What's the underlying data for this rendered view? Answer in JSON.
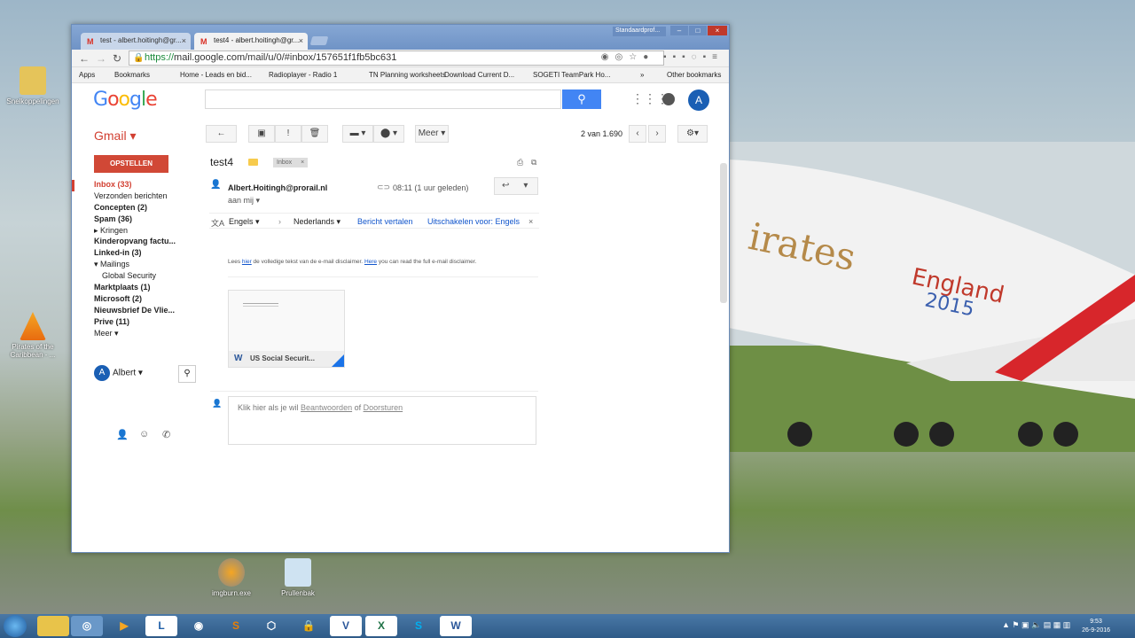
{
  "desktop": {
    "icons": [
      {
        "label": "Snelkoppelingen"
      },
      {
        "label": "Pirates of the Caribbean - ..."
      },
      {
        "label": "imgburn.exe"
      },
      {
        "label": "Prullenbak"
      }
    ]
  },
  "browser": {
    "tabs": [
      {
        "label": "test - albert.hoitingh@gr..."
      },
      {
        "label": "test4 - albert.hoitingh@gr..."
      }
    ],
    "profile": "Standaardprof...",
    "url_secure": "https://",
    "url_rest": "mail.google.com/mail/u/0/#inbox/157651f1fb5bc631",
    "bookmarks": [
      "Apps",
      "Bookmarks",
      "Home - Leads en bid...",
      "Radioplayer - Radio 1",
      "TN Planning worksheets",
      "Download Current D...",
      "SOGETI TeamPark Ho...",
      "»",
      "Other bookmarks"
    ]
  },
  "gmail": {
    "logo": "Google",
    "app_label": "Gmail ▾",
    "avatar_letter": "A",
    "toolbar": {
      "back": "←",
      "archive": "▣",
      "spam": "!",
      "delete": "🗑",
      "move": "▬ ▾",
      "labels": "⬤ ▾",
      "more": "Meer ▾"
    },
    "pager": "2 van 1.690",
    "compose": "OPSTELLEN",
    "labels": [
      {
        "text": "Inbox (33)",
        "style": "active"
      },
      {
        "text": "Verzonden berichten",
        "style": ""
      },
      {
        "text": "Concepten (2)",
        "style": "bold"
      },
      {
        "text": "Spam (36)",
        "style": "bold"
      },
      {
        "text": "▸ Kringen",
        "style": ""
      },
      {
        "text": "Kinderopvang factu...",
        "style": "bold"
      },
      {
        "text": "Linked-in (3)",
        "style": "bold"
      },
      {
        "text": "▾ Mailings",
        "style": ""
      },
      {
        "text": "Global Security",
        "style": "sub"
      },
      {
        "text": "Marktplaats (1)",
        "style": "bold"
      },
      {
        "text": "Microsoft (2)",
        "style": "bold"
      },
      {
        "text": "Nieuwsbrief De Vlie...",
        "style": "bold"
      },
      {
        "text": "Prive (11)",
        "style": "bold"
      },
      {
        "text": "Meer ▾",
        "style": ""
      }
    ],
    "chat_user": "Albert ▾",
    "message": {
      "subject": "test4",
      "tag": "Inbox",
      "sender": "Albert.Hoitingh@prorail.nl",
      "to": "aan mij ▾",
      "time": "08:11 (1 uur geleden)",
      "translate": {
        "from": "Engels ▾",
        "to": "Nederlands ▾",
        "action": "Bericht vertalen",
        "disable": "Uitschakelen voor: Engels",
        "close": "×"
      },
      "disclaimer_1": "Lees ",
      "disclaimer_link1": "hier",
      "disclaimer_2": " de volledige tekst van de e-mail disclaimer. ",
      "disclaimer_link2": "Here",
      "disclaimer_3": " you can read the full e-mail disclaimer.",
      "attachment": "US Social Securit...",
      "reply_prompt": "Klik hier als je wil ",
      "reply_link": "Beantwoorden",
      "reply_or": " of ",
      "forward_link": "Doorsturen"
    }
  },
  "taskbar": {
    "clock_time": "9:53",
    "clock_date": "26-9-2016"
  },
  "colors": {
    "gmail_red": "#d23f31",
    "google_blue": "#4285f4",
    "link_blue": "#1155cc"
  }
}
